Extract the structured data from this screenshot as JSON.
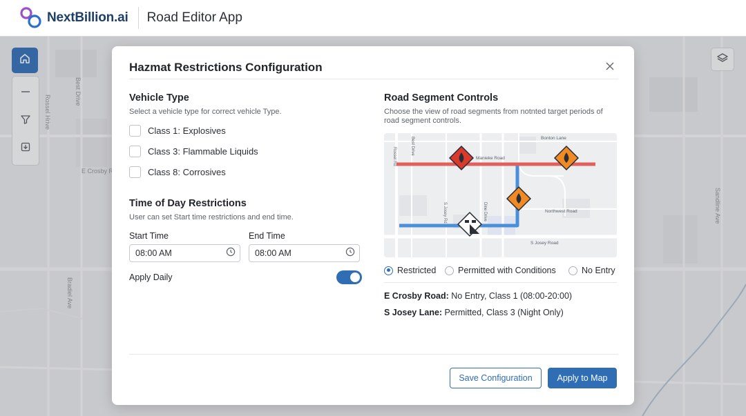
{
  "header": {
    "brand_name": "NextBillion.ai",
    "app_title": "Road Editor App",
    "logo_icon": "nextbillion-logo-icon"
  },
  "map_labels": {
    "street_1": "Best Drive",
    "street_2": "Rossel Hrive",
    "street_3": "E Crosby R",
    "street_4": "Bradiel Ave",
    "street_5": "Sandline Ave"
  },
  "toolbar": {
    "icons": [
      "home-icon",
      "minus-icon",
      "filter-icon",
      "download-icon",
      "layers-icon"
    ]
  },
  "modal": {
    "title": "Hazmat Restrictions Configuration",
    "vehicle_type": {
      "title": "Vehicle Type",
      "description": "Select a vehicle type for correct vehicle Type.",
      "options": [
        {
          "label": "Class 1: Explosives",
          "checked": false
        },
        {
          "label": "Class 3: Flammable Liquids",
          "checked": false
        },
        {
          "label": "Class 8: Corrosives",
          "checked": false
        }
      ]
    },
    "time_of_day": {
      "title": "Time of Day Restrictions",
      "description": "User can set Start time restrictions and end time.",
      "start_label": "Start Time",
      "start_value": "08:00 AM",
      "end_label": "End Time",
      "end_value": "08:00 AM",
      "apply_daily_label": "Apply Daily",
      "apply_daily_on": true
    },
    "road_segment": {
      "title": "Road Segment Controls",
      "description_line1": "Choose the view of road segments from notnted target periods of",
      "description_line2": "road segment controls.",
      "map_labels": {
        "bonton": "Bonton Lane",
        "manieke": "Manieke Road",
        "northwest": "Northwest Road",
        "josey_road": "S Josey Road",
        "rossel": "Rossel Rd",
        "best": "Best Drive",
        "josey_vert": "S Josey Rd",
        "dine": "Dine Drive"
      },
      "colors": {
        "restricted": "#e0605d",
        "permitted": "#4a8fd8",
        "hazard_orange": "#f08a24",
        "hazard_red": "#d93a2b"
      },
      "radio_options": [
        {
          "label": "Restricted",
          "checked": true
        },
        {
          "label": "Permitted with Conditions",
          "checked": false
        },
        {
          "label": "No Entry",
          "checked": false
        }
      ],
      "segments": [
        {
          "road": "E Crosby Road:",
          "detail": " No Entry, Class 1 (08:00-20:00)"
        },
        {
          "road": "S Josey Lane:",
          "detail": " Permitted, Class 3 (Night Only)"
        }
      ]
    },
    "buttons": {
      "save": "Save Configuration",
      "apply": "Apply to Map"
    }
  }
}
